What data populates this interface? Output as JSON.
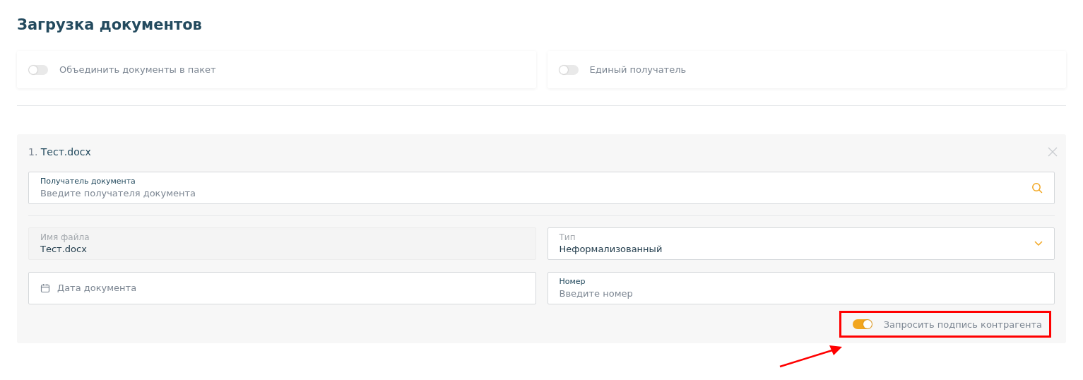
{
  "title": "Загрузка документов",
  "options": [
    {
      "label": "Объединить документы в пакет",
      "on": false
    },
    {
      "label": "Единый получатель",
      "on": false
    }
  ],
  "documents": [
    {
      "index": "1.",
      "name": "Тест.docx",
      "recipient": {
        "kind": "search",
        "label": "Получатель документа",
        "placeholder": "Введите получателя документа"
      },
      "fields": [
        {
          "kind": "readonly",
          "label": "Имя файла",
          "value": "Тест.docx"
        },
        {
          "kind": "select",
          "label": "Тип",
          "value": "Неформализованный"
        },
        {
          "kind": "date",
          "placeholder": "Дата документа"
        },
        {
          "kind": "input",
          "label": "Номер",
          "placeholder": "Введите номер"
        }
      ],
      "signature": {
        "label": "Запросить подпись контрагента",
        "on": true,
        "highlighted": true
      }
    }
  ]
}
